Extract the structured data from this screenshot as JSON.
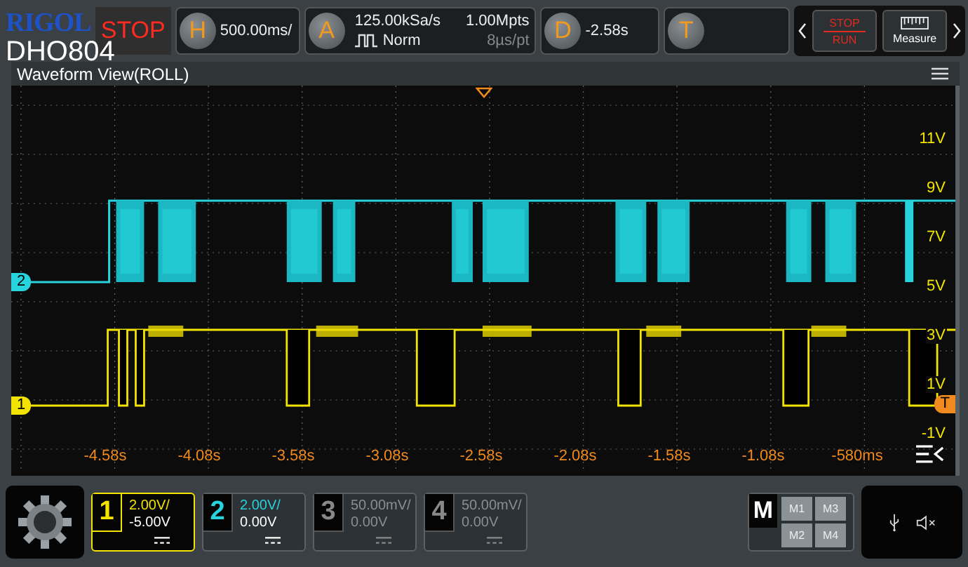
{
  "brand": "RIGOL",
  "run_state": "STOP",
  "model": "DHO804",
  "horizontal": {
    "label": "H",
    "value": "500.00ms/"
  },
  "acquire": {
    "label": "A",
    "sample_rate": "125.00kSa/s",
    "mode": "Norm",
    "memory_depth": "1.00Mpts",
    "sample_interval": "8µs/pt"
  },
  "delay": {
    "label": "D",
    "value": "-2.58s"
  },
  "trigger": {
    "label": "T"
  },
  "right_buttons": [
    {
      "kind": "stop-run",
      "top": "STOP",
      "bottom": "RUN"
    },
    {
      "kind": "measure",
      "label": "Measure"
    }
  ],
  "view": {
    "title": "Waveform View(ROLL)",
    "volt_labels": [
      "11V",
      "9V",
      "7V",
      "5V",
      "3V",
      "1V",
      "-1V"
    ],
    "time_labels": [
      "-4.58s",
      "-4.08s",
      "-3.58s",
      "-3.08s",
      "-2.58s",
      "-2.08s",
      "-1.58s",
      "-1.08s",
      "-580ms"
    ],
    "markers": [
      {
        "label": "2",
        "color": "#27d3dc",
        "kind": "channel"
      },
      {
        "label": "1",
        "color": "#f2e400",
        "kind": "channel"
      },
      {
        "label": "T",
        "color": "#f08a1e",
        "kind": "trigger"
      }
    ]
  },
  "channels": [
    {
      "number": "1",
      "scale": "2.00V/",
      "offset": "-5.00V",
      "on": true,
      "selected": true,
      "color": "#f2e400"
    },
    {
      "number": "2",
      "scale": "2.00V/",
      "offset": "0.00V",
      "on": true,
      "selected": false,
      "color": "#27d3dc"
    },
    {
      "number": "3",
      "scale": "50.00mV/",
      "offset": "0.00V",
      "on": false,
      "selected": false
    },
    {
      "number": "4",
      "scale": "50.00mV/",
      "offset": "0.00V",
      "on": false,
      "selected": false
    }
  ],
  "math": {
    "label": "M",
    "items": [
      "M1",
      "M3",
      "M2",
      "M4"
    ]
  }
}
